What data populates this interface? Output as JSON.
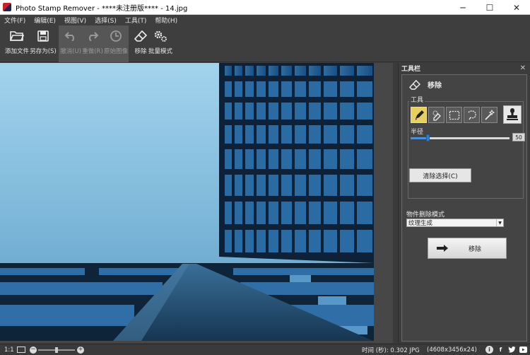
{
  "window": {
    "title": "Photo Stamp Remover - ****未注册版**** - 14.jpg"
  },
  "menu": [
    "文件(F)",
    "编辑(E)",
    "视图(V)",
    "选择(S)",
    "工具(T)",
    "帮助(H)"
  ],
  "toolbar": {
    "add_files": "添加文件",
    "save_as": "另存为(S)",
    "undo": "撤消(U)",
    "redo": "重做(R)",
    "original": "原始图像",
    "remove": "移除",
    "batch": "批量模式"
  },
  "panel": {
    "header": "工具栏",
    "tool_title": "移除",
    "group_label": "工具",
    "radius_label": "半径",
    "radius_value": "50",
    "radius_fraction": 0.17,
    "clear_selection": "清除选择(C)",
    "mode_label": "物件删除模式",
    "mode_value": "纹理生成",
    "remove_button": "移除"
  },
  "status": {
    "zoom_ratio": "1:1",
    "zoom_level": 0.5,
    "time": "时间 (秒): 0.302 JPG",
    "dimensions": "(4608x3456x24)"
  },
  "colors": {
    "accent_yellow": "#e6d060",
    "dark_bg": "#3c3c3c"
  }
}
